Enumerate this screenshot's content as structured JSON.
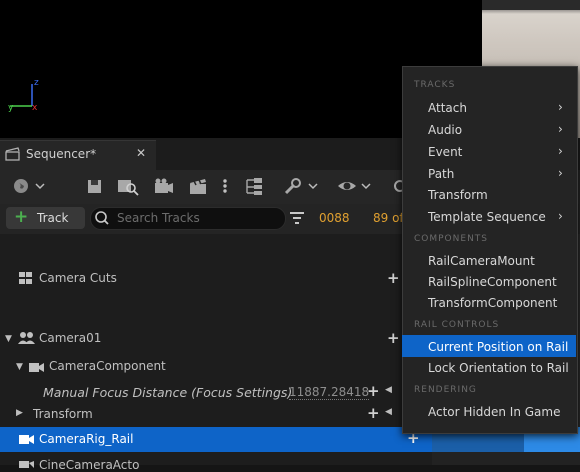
{
  "sequencer": {
    "tab_title": "Sequencer*",
    "add_track_label": "Track",
    "search_placeholder": "Search Tracks",
    "frame_current": "0088",
    "frame_total": "89 of"
  },
  "tracks": {
    "camera_cuts": "Camera Cuts",
    "camera01": "Camera01",
    "camera_component": "CameraComponent",
    "manual_focus": "Manual Focus Distance (Focus Settings)",
    "manual_focus_value": "11887.28418",
    "transform": "Transform",
    "camera_rig": "CameraRig_Rail",
    "cine_camera_partial": "CineCameraActo"
  },
  "menu": {
    "header_tracks": "TRACKS",
    "header_components": "COMPONENTS",
    "header_rail_controls": "RAIL CONTROLS",
    "header_rendering": "RENDERING",
    "tracks_items": [
      "Attach",
      "Audio",
      "Event",
      "Path",
      "Transform",
      "Template Sequence"
    ],
    "component_items": [
      "RailCameraMount",
      "RailSplineComponent",
      "TransformComponent"
    ],
    "rail_items": [
      "Current Position on Rail",
      "Lock Orientation to Rail"
    ],
    "rendering_items": [
      "Actor Hidden In Game"
    ]
  },
  "colors": {
    "accent_blue": "#0e64c8",
    "frame_orange": "#e0a030",
    "add_green": "#4caf50"
  }
}
